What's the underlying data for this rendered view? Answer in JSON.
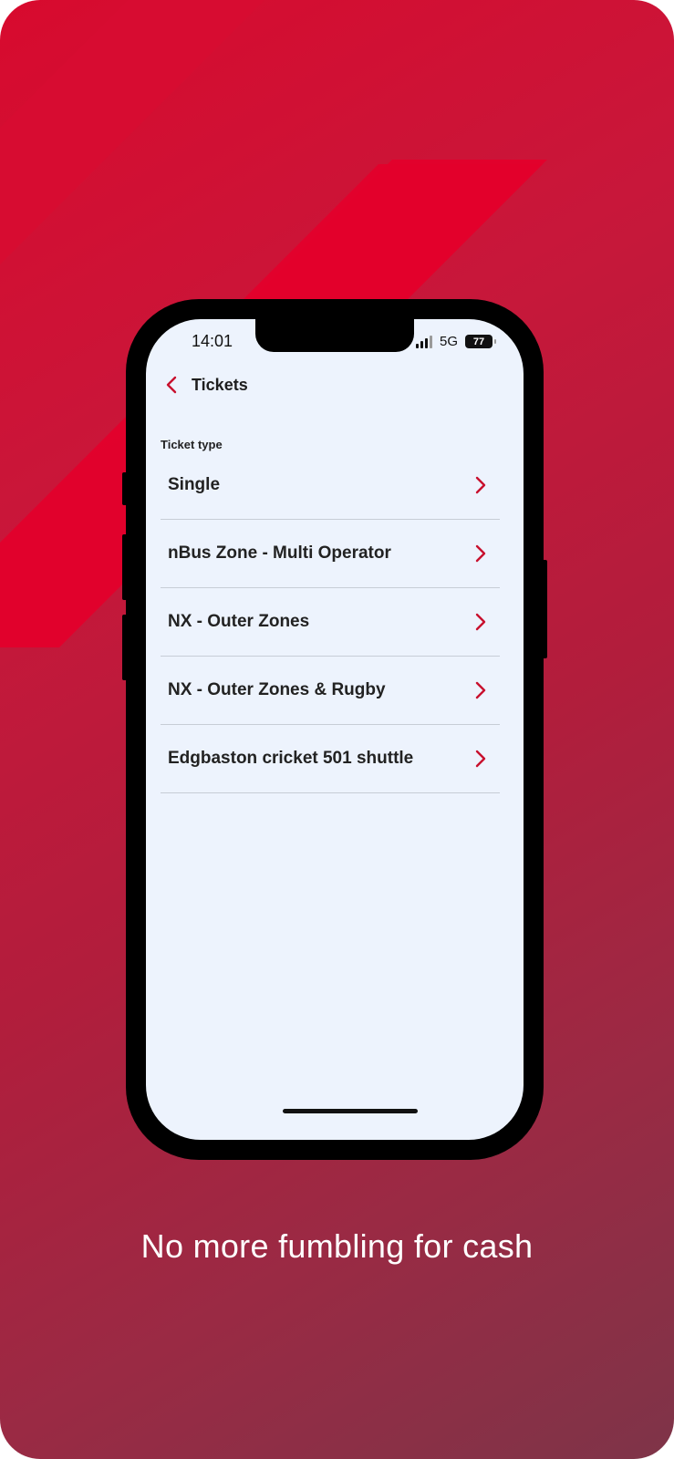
{
  "status_bar": {
    "time": "14:01",
    "network": "5G",
    "battery": "77"
  },
  "header": {
    "back_icon": "chevron-left-icon",
    "title": "Tickets"
  },
  "ticket_section": {
    "label": "Ticket type",
    "items": [
      {
        "label": "Single"
      },
      {
        "label": "nBus Zone - Multi Operator"
      },
      {
        "label": "NX - Outer Zones"
      },
      {
        "label": "NX - Outer Zones & Rugby"
      },
      {
        "label": "Edgbaston cricket 501 shuttle"
      }
    ]
  },
  "caption": "No more fumbling for cash",
  "colors": {
    "accent": "#c8102e",
    "screen_bg": "#edf3fd"
  }
}
